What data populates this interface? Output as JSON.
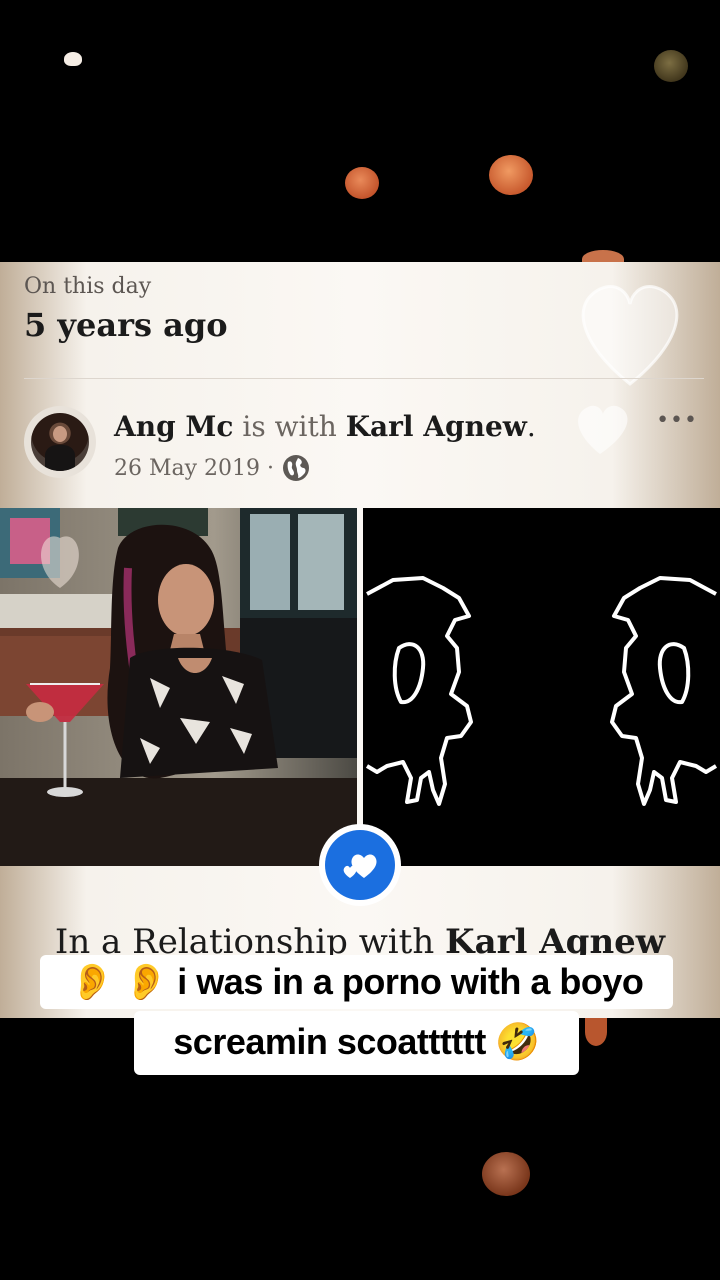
{
  "memory": {
    "header_label": "On this day",
    "years_ago": "5 years ago"
  },
  "post": {
    "author": "Ang Mc",
    "with_word": "is with",
    "tagged": "Karl Agnew",
    "date": "26 May 2019 ·",
    "privacy_icon": "globe-icon",
    "more_icon": "more-options-icon",
    "more_label": "•••"
  },
  "life_event": {
    "icon": "hearts-icon",
    "prefix": "In a Relationship with",
    "name": "Karl Agnew"
  },
  "caption": {
    "line1": "👂 👂 i was in a porno with a boyo",
    "line2": "screamin scoatttttt 🤣"
  },
  "colors": {
    "accent_blue": "#1b6fe0",
    "card_bg": "#fbf8f4",
    "bokeh_orange": "#d97048"
  }
}
